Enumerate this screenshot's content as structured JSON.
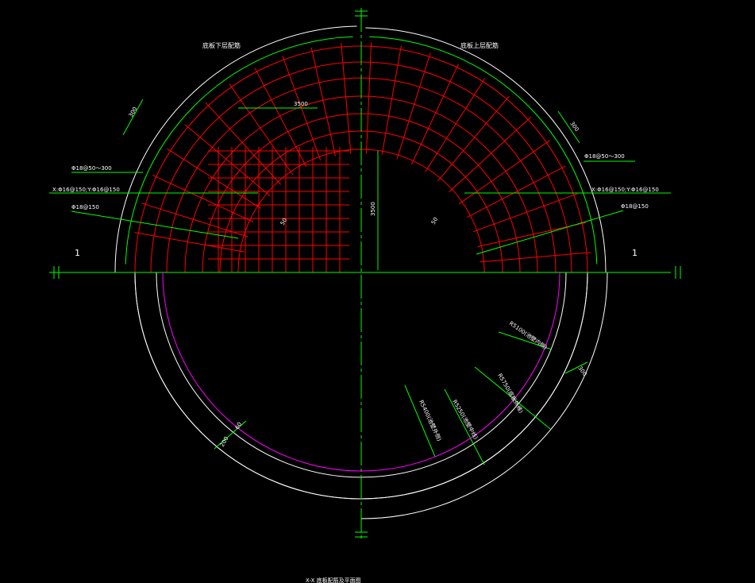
{
  "drawing": {
    "titles": {
      "left": "底板下层配筋",
      "right": "底板上层配筋"
    },
    "bottom_caption": "X-X 底板配筋及平面图",
    "section_marks": {
      "left": "1",
      "right": "1"
    },
    "dimensions": {
      "d300_left": "300",
      "d300_right": "300",
      "d3500_h": "3500",
      "d3500_v": "3500",
      "d50_left": "50",
      "d50_right": "50",
      "d200": "200",
      "d60": "60",
      "d300_ring": "300"
    },
    "rebar_labels": {
      "left_1": "Φ18@50～300",
      "left_2": "X:Φ16@150;Y:Φ16@150",
      "left_3": "Φ18@150",
      "right_1": "Φ18@50～300",
      "right_2": "X:Φ16@150;Y:Φ16@150",
      "right_3": "Φ18@150"
    },
    "radius_labels": {
      "r1": "R5100(池壁内侧)",
      "r2": "R5400(池壁外侧)",
      "r3": "R5250(池壁中线)",
      "r4": "R5750(底板外缘)"
    },
    "colors": {
      "background": "#000000",
      "outline": "#ffffff",
      "rebar": "#ff0000",
      "dimension": "#00ff00",
      "centerline": "#00cc00",
      "wall": "#ff00ff"
    }
  }
}
